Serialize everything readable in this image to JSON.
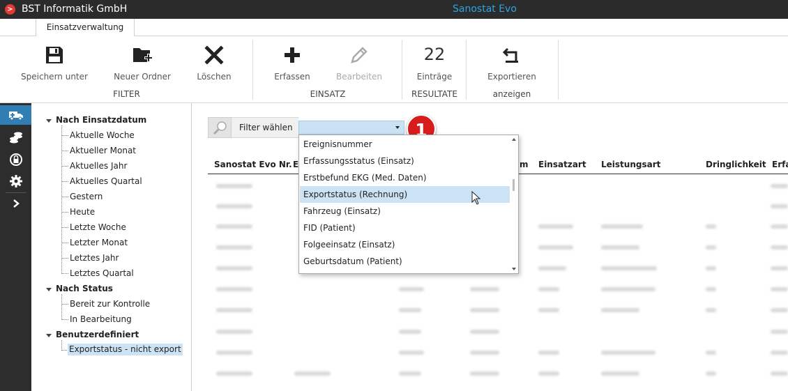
{
  "titlebar": {
    "logo_glyph": ">",
    "company": "BST Informatik GmbH",
    "app_title": "Sanostat Evo"
  },
  "tabs": [
    {
      "label": "Einsatzverwaltung"
    }
  ],
  "ribbon": {
    "filter": {
      "save_as": "Speichern unter",
      "new_folder": "Neuer Ordner",
      "delete": "Löschen",
      "group": "FILTER"
    },
    "einsatz": {
      "create": "Erfassen",
      "edit": "Bearbeiten",
      "group": "EINSATZ"
    },
    "results": {
      "count": "22",
      "entries": "Einträge",
      "group": "RESULTATE"
    },
    "export": {
      "label": "Exportieren",
      "group": "anzeigen"
    }
  },
  "tree": {
    "cat_date": "Nach Einsatzdatum",
    "date_items": [
      "Aktuelle Woche",
      "Aktueller Monat",
      "Aktuelles Jahr",
      "Aktuelles Quartal",
      "Gestern",
      "Heute",
      "Letzte Woche",
      "Letzter Monat",
      "Letztes Jahr",
      "Letztes Quartal"
    ],
    "cat_status": "Nach Status",
    "status_items": [
      "Bereit zur Kontrolle",
      "In Bearbeitung"
    ],
    "cat_custom": "Benutzerdefiniert",
    "custom_items": [
      "Exportstatus - nicht export"
    ]
  },
  "filter": {
    "label": "Filter wählen",
    "selected": ""
  },
  "badge": "1",
  "table": {
    "headers": [
      "Sanostat Evo Nr.",
      "E",
      "m",
      "Einsatzart",
      "Leistungsart",
      "Dringlichkeit",
      "Erfa"
    ]
  },
  "dropdown": {
    "options": [
      "Ereignisnummer",
      "Erfassungsstatus (Einsatz)",
      "Erstbefund EKG (Med. Daten)",
      "Exportstatus (Rechnung)",
      "Fahrzeug (Einsatz)",
      "FID (Patient)",
      "Folgeeinsatz (Einsatz)",
      "Geburtsdatum (Patient)"
    ],
    "hovered": "Exportstatus (Rechnung)"
  },
  "colors": {
    "accent": "#2ea3e0",
    "selection": "#cbe3f5",
    "badge": "#d81b1b",
    "sidebar": "#2d2d2d"
  }
}
